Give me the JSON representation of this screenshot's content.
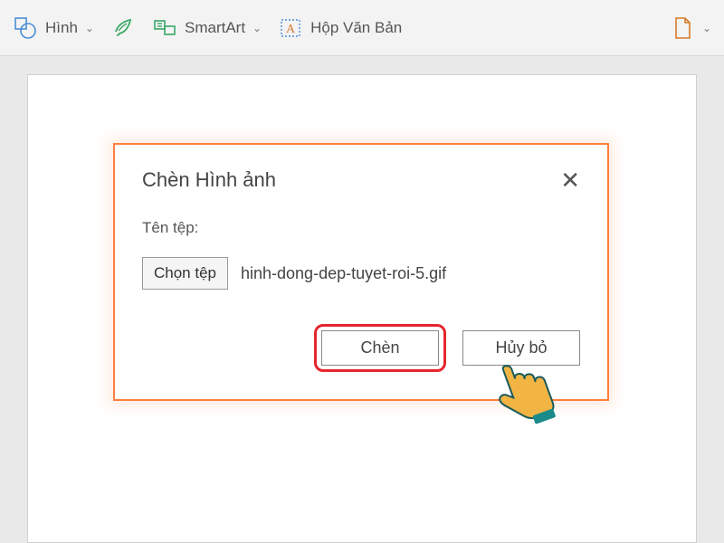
{
  "toolbar": {
    "shape_label": "Hình",
    "smartart_label": "SmartArt",
    "textbox_label": "Hộp Văn Bản"
  },
  "dialog": {
    "title": "Chèn Hình ảnh",
    "field_label": "Tên tệp:",
    "choose_file_label": "Chọn tệp",
    "selected_file": "hinh-dong-dep-tuyet-roi-5.gif",
    "insert_label": "Chèn",
    "cancel_label": "Hủy bỏ"
  }
}
